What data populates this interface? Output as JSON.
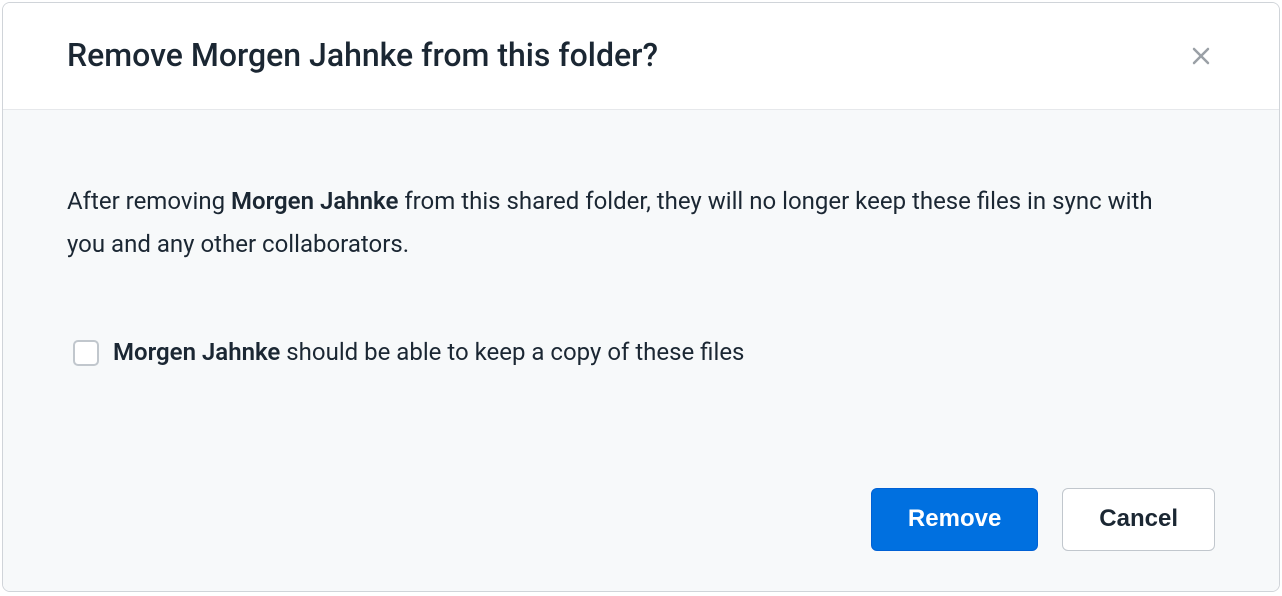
{
  "dialog": {
    "title": "Remove Morgen Jahnke from this folder?",
    "description_prefix": "After removing ",
    "description_name": "Morgen Jahnke",
    "description_suffix": " from this shared folder, they will no longer keep these files in sync with you and any other collaborators.",
    "checkbox_name": "Morgen Jahnke",
    "checkbox_suffix": " should be able to keep a copy of these files",
    "remove_label": "Remove",
    "cancel_label": "Cancel"
  }
}
